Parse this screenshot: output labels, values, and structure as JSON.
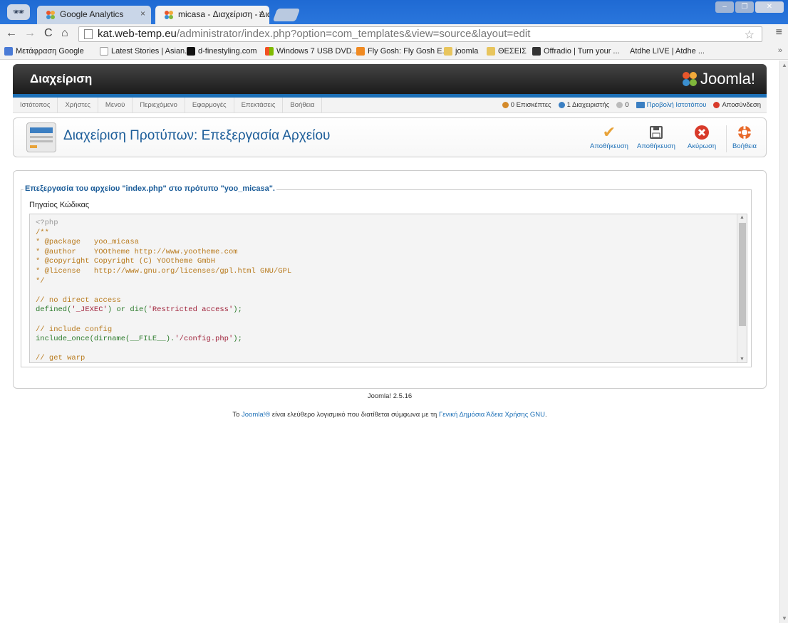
{
  "browser": {
    "tabs": [
      {
        "title": "Google Analytics",
        "active": false
      },
      {
        "title": "micasa - Διαχείριση - Διαχ",
        "active": true
      }
    ],
    "url_host": "kat.web-temp.eu",
    "url_path": "/administrator/index.php?option=com_templates&view=source&layout=edit",
    "bookmarks": [
      {
        "label": "Μετάφραση Google",
        "icon_color": "#4a7bd6"
      },
      {
        "label": "Latest Stories | Asian...",
        "icon_color": "#ffffff"
      },
      {
        "label": "d-finestyling.com",
        "icon_color": "#111111"
      },
      {
        "label": "Windows 7 USB DVD...",
        "icon_color": "#2aa7e8"
      },
      {
        "label": "Fly Gosh: Fly Gosh E...",
        "icon_color": "#f08a22"
      },
      {
        "label": "joomla",
        "icon_color": "#e8c55d"
      },
      {
        "label": "ΘΕΣΕΙΣ",
        "icon_color": "#e8c55d"
      },
      {
        "label": "Offradio | Turn your ...",
        "icon_color": "#333333"
      },
      {
        "label": "Atdhe LIVE | Atdhe ...",
        "icon_color": "#f2f2f2"
      }
    ]
  },
  "admin": {
    "header_title": "Διαχείριση",
    "logo_text": "Joomla!",
    "menu": [
      "Ιστότοπος",
      "Χρήστες",
      "Μενού",
      "Περιεχόμενο",
      "Εφαρμογές",
      "Επεκτάσεις",
      "Βοήθεια"
    ],
    "status": {
      "visitors": "0 Επισκέπτες",
      "admins": "1 Διαχειριστής",
      "messages": "0",
      "view_site": "Προβολή Ιστοτόπου",
      "logout": "Αποσύνδεση"
    },
    "page_title": "Διαχείριση Προτύπων: Επεξεργασία Αρχείου",
    "toolbar": [
      {
        "label": "Αποθήκευση",
        "icon": "check-icon",
        "color": "#e8a33a"
      },
      {
        "label": "Αποθήκευση",
        "icon": "save-icon",
        "color": "#555555"
      },
      {
        "label": "Ακύρωση",
        "icon": "cancel-icon",
        "color": "#d83a2a"
      },
      {
        "label": "Βοήθεια",
        "icon": "help-icon",
        "color": "#e86a2a"
      }
    ]
  },
  "editor": {
    "legend": "Επεξεργασία του αρχείου \"index.php\" στο πρότυπο \"yoo_micasa\".",
    "label": "Πηγαίος Κώδικας"
  },
  "footer": {
    "version": "Joomla! 2.5.16",
    "license_prefix": "Το ",
    "license_link1": "Joomla!®",
    "license_middle": " είναι ελεύθερο λογισμικό που διατίθεται σύμφωνα με τη ",
    "license_link2": "Γενική Δημόσια Άδεια Χρήσης GNU",
    "license_suffix": "."
  }
}
